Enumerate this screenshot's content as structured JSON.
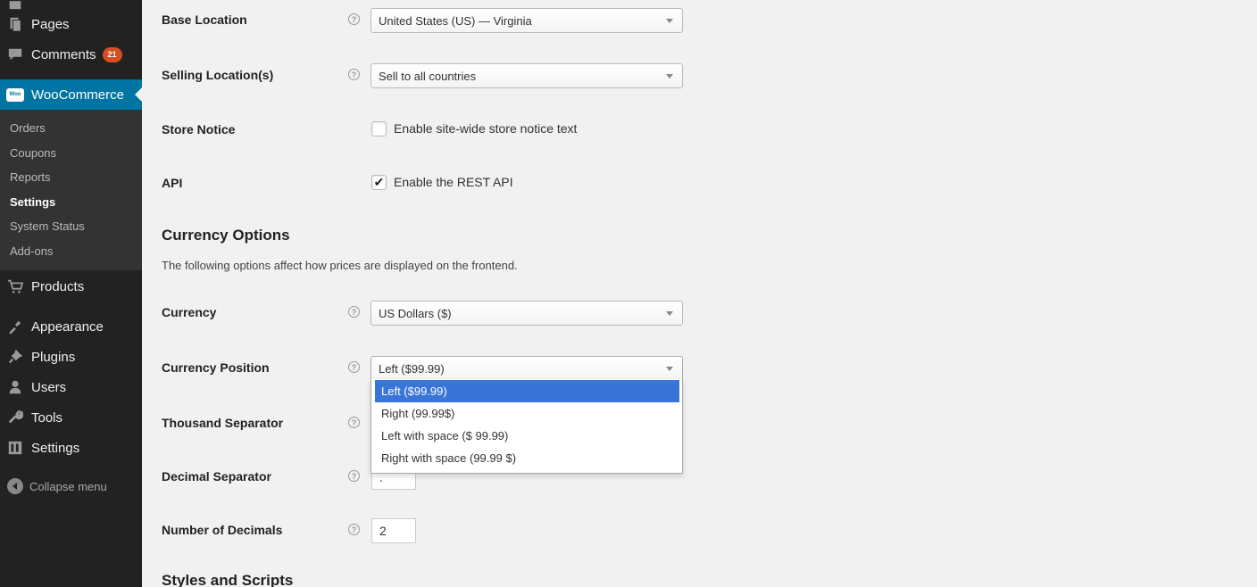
{
  "sidebar": {
    "items": [
      {
        "label": "Pages",
        "icon": "pages-icon"
      },
      {
        "label": "Comments",
        "icon": "comments-icon",
        "badge": "21"
      },
      {
        "label": "WooCommerce",
        "icon": "woocommerce-icon",
        "logo_text": "Woo"
      },
      {
        "label": "Products",
        "icon": "products-icon"
      },
      {
        "label": "Appearance",
        "icon": "appearance-icon"
      },
      {
        "label": "Plugins",
        "icon": "plugins-icon"
      },
      {
        "label": "Users",
        "icon": "users-icon"
      },
      {
        "label": "Tools",
        "icon": "tools-icon"
      },
      {
        "label": "Settings",
        "icon": "settings-icon"
      }
    ],
    "submenu": [
      "Orders",
      "Coupons",
      "Reports",
      "Settings",
      "System Status",
      "Add-ons"
    ],
    "collapse_label": "Collapse menu",
    "accent_color": "#0074a2",
    "badge_color": "#d54e21"
  },
  "form": {
    "base_location": {
      "label": "Base Location",
      "value": "United States (US) — Virginia"
    },
    "selling_locations": {
      "label": "Selling Location(s)",
      "value": "Sell to all countries"
    },
    "store_notice": {
      "label": "Store Notice",
      "checkbox_label": "Enable site-wide store notice text",
      "checked": false
    },
    "api": {
      "label": "API",
      "checkbox_label": "Enable the REST API",
      "checked": true
    },
    "currency_section": {
      "title": "Currency Options",
      "description": "The following options affect how prices are displayed on the frontend."
    },
    "currency": {
      "label": "Currency",
      "value": "US Dollars ($)"
    },
    "currency_position": {
      "label": "Currency Position",
      "value": "Left ($99.99)",
      "options": [
        "Left ($99.99)",
        "Right (99.99$)",
        "Left with space ($ 99.99)",
        "Right with space (99.99 $)"
      ],
      "highlighted": "Left ($99.99)"
    },
    "thousand_separator": {
      "label": "Thousand Separator"
    },
    "decimal_separator": {
      "label": "Decimal Separator",
      "value": "."
    },
    "number_of_decimals": {
      "label": "Number of Decimals",
      "value": "2"
    },
    "styles_section": {
      "title": "Styles and Scripts"
    },
    "help_glyph": "?",
    "check_glyph": "✔"
  }
}
